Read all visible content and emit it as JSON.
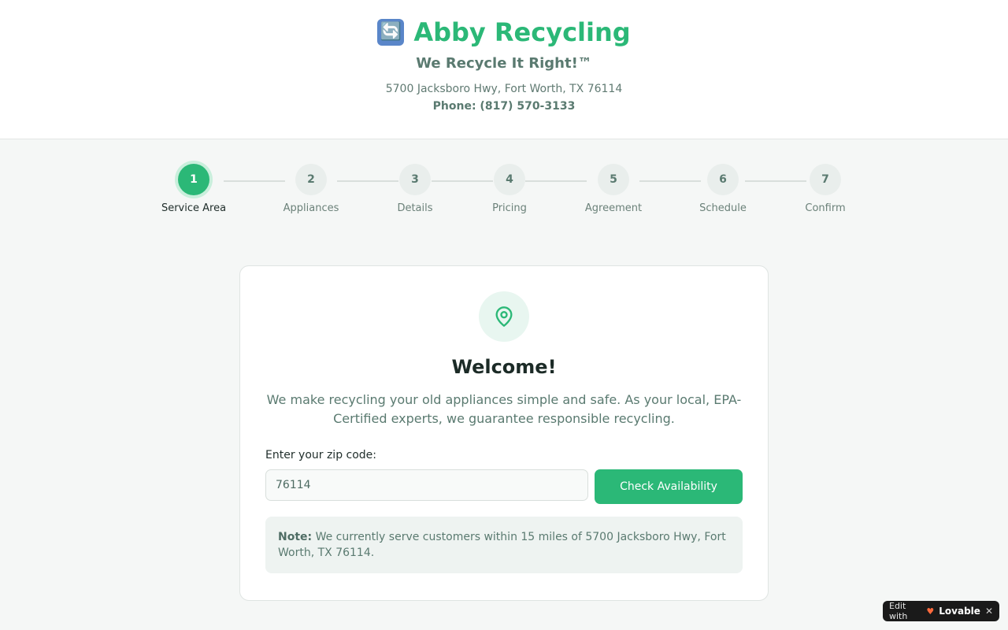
{
  "header": {
    "brand_icon": "🔄",
    "brand_name": "Abby Recycling",
    "tagline": "We Recycle It Right!™",
    "address": "5700 Jacksboro Hwy, Fort Worth, TX 76114",
    "phone": "Phone: (817) 570-3133"
  },
  "steps": [
    {
      "number": "1",
      "label": "Service Area",
      "active": true
    },
    {
      "number": "2",
      "label": "Appliances",
      "active": false
    },
    {
      "number": "3",
      "label": "Details",
      "active": false
    },
    {
      "number": "4",
      "label": "Pricing",
      "active": false
    },
    {
      "number": "5",
      "label": "Agreement",
      "active": false
    },
    {
      "number": "6",
      "label": "Schedule",
      "active": false
    },
    {
      "number": "7",
      "label": "Confirm",
      "active": false
    }
  ],
  "card": {
    "icon": "map-pin-icon",
    "title": "Welcome!",
    "intro": "We make recycling your old appliances simple and safe. As your local, EPA-Certified experts, we guarantee responsible recycling.",
    "zip_label": "Enter your zip code:",
    "zip_value": "76114",
    "check_button": "Check Availability",
    "note_bold": "Note:",
    "note_text": " We currently serve customers within 15 miles of 5700 Jacksboro Hwy, Fort Worth, TX 76114."
  },
  "badge": {
    "prefix": "Edit with",
    "brand": "Lovable",
    "close": "✕"
  },
  "colors": {
    "accent": "#2bb877",
    "muted_text": "#5a7a70",
    "background": "#f5f7f6"
  }
}
